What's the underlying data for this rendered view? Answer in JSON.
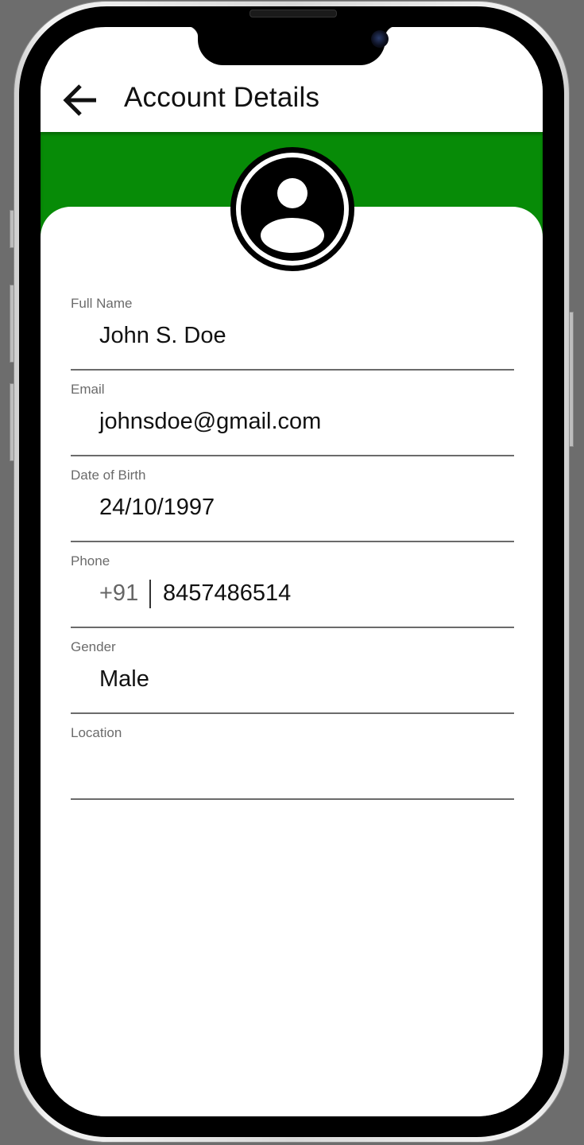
{
  "app_bar": {
    "title": "Account Details",
    "back_icon": "arrow-left-icon"
  },
  "profile": {
    "avatar_icon": "account-circle-icon"
  },
  "colors": {
    "header_band": "#078b07",
    "text_primary": "#111111",
    "label": "#6b6b6b",
    "underline": "#6b6b6b"
  },
  "fields": {
    "full_name": {
      "label": "Full Name",
      "value": "John S. Doe"
    },
    "email": {
      "label": "Email",
      "value": "johnsdoe@gmail.com"
    },
    "dob": {
      "label": "Date of Birth",
      "value": "24/10/1997"
    },
    "phone": {
      "label": "Phone",
      "country_code": "+91",
      "number": "8457486514"
    },
    "gender": {
      "label": "Gender",
      "value": "Male"
    },
    "location": {
      "label": "Location",
      "value": ""
    }
  }
}
